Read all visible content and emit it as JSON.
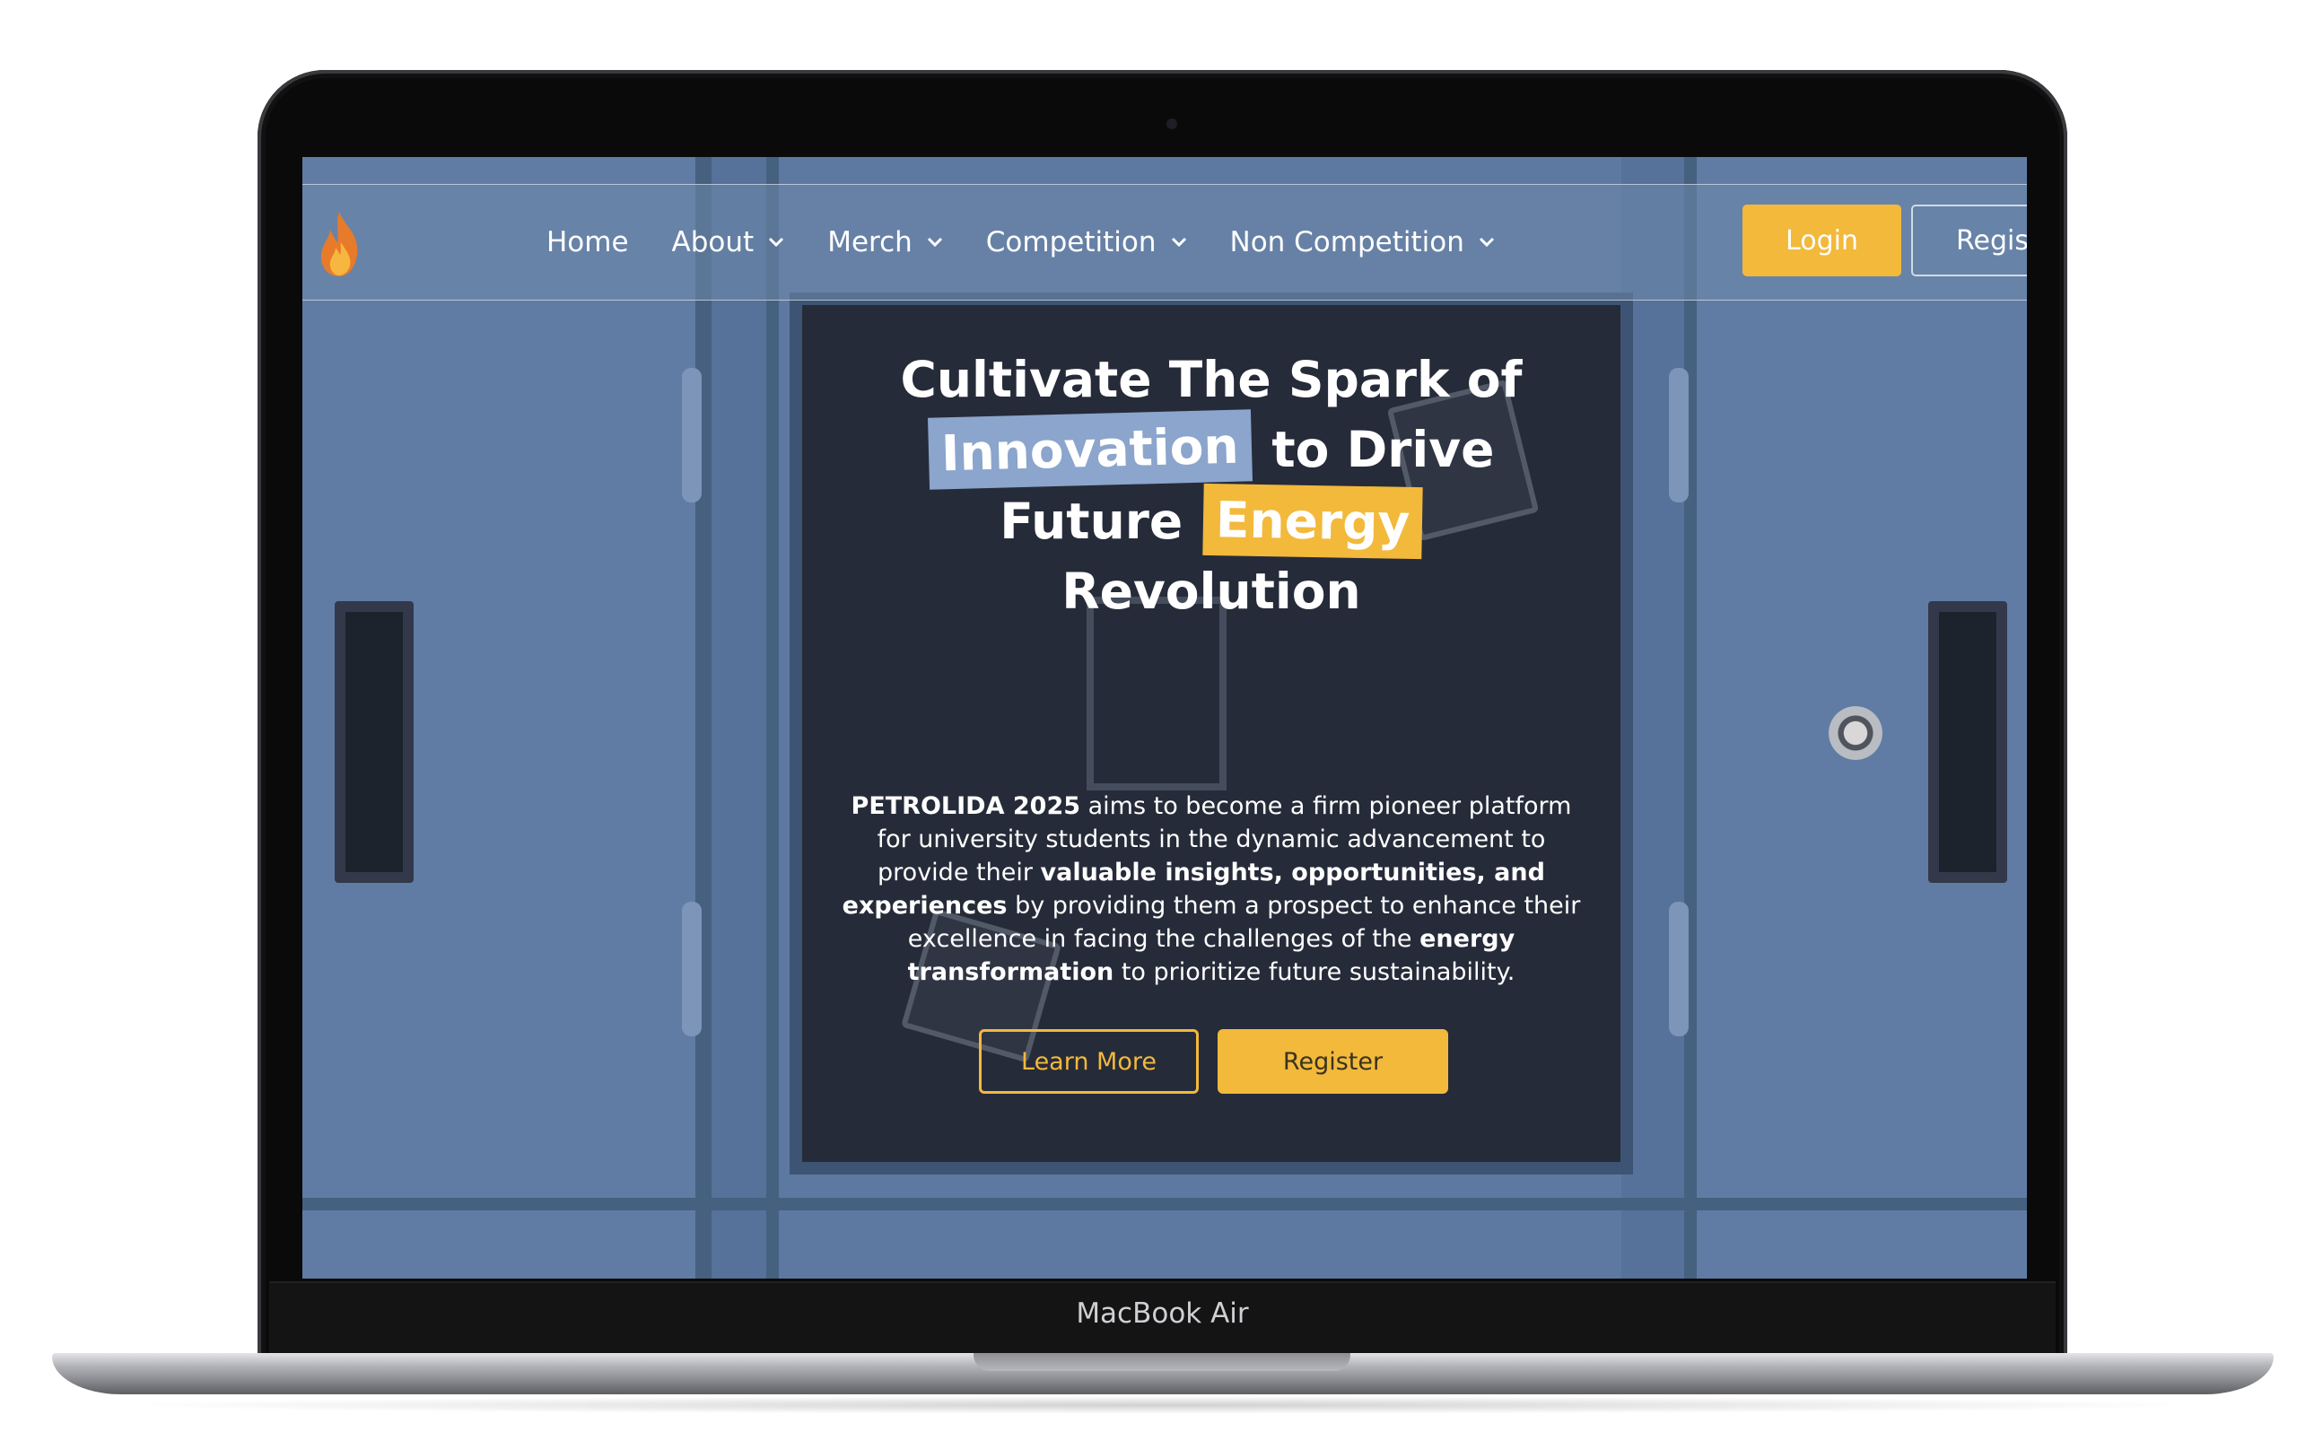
{
  "device": {
    "label": "MacBook Air"
  },
  "header": {
    "nav_items": [
      {
        "label": "Home",
        "dropdown": false
      },
      {
        "label": "About",
        "dropdown": true
      },
      {
        "label": "Merch",
        "dropdown": true
      },
      {
        "label": "Competition",
        "dropdown": true
      },
      {
        "label": "Non Competition",
        "dropdown": true
      }
    ],
    "login_label": "Login",
    "register_label": "Regis"
  },
  "hero": {
    "title_line1": "Cultivate The Spark of",
    "highlight_innovation": "Innovation",
    "title_line2_rest": "to Drive",
    "title_line3_start": "Future",
    "highlight_energy": "Energy",
    "title_line4": "Revolution",
    "desc_brand": "PETROLIDA 2025",
    "desc_part1": " aims to become a firm pioneer platform for university students in the dynamic advancement to provide their ",
    "desc_bold1": "valuable insights, opportunities, and experiences",
    "desc_part2": " by providing them a prospect to enhance their excellence in facing the challenges of the ",
    "desc_bold2": "energy transformation",
    "desc_part3": " to prioritize future sustainability.",
    "learn_more_label": "Learn More",
    "register_label": "Register"
  },
  "colors": {
    "accent_yellow": "#f2b93b",
    "highlight_blue": "#8ba5cc",
    "card_dark": "#262b39",
    "locker_blue": "#5f7ba4"
  },
  "icons": [
    "flame-logo-icon",
    "chevron-down-icon",
    "camera-icon"
  ]
}
